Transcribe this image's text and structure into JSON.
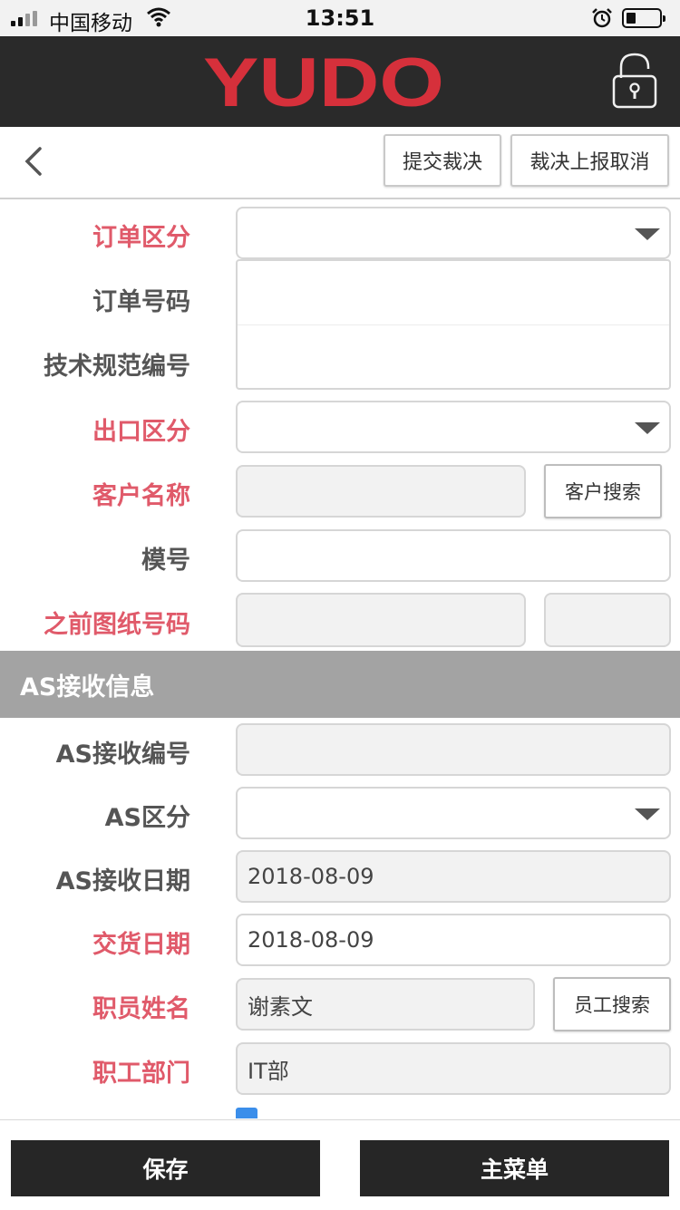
{
  "status_bar": {
    "carrier": "中国移动",
    "time": "13:51"
  },
  "header": {
    "logo_text": "YUDO",
    "brand_color": "#d6303b",
    "lock_icon": "lock-icon"
  },
  "toolbar": {
    "back_icon": "chevron-left-icon",
    "submit_label": "提交裁决",
    "cancel_report_label": "裁决上报取消"
  },
  "form": {
    "order_type": {
      "label": "订单区分",
      "value": ""
    },
    "order_number": {
      "label": "订单号码",
      "value": ""
    },
    "spec_number": {
      "label": "技术规范编号",
      "value": ""
    },
    "export_type": {
      "label": "出口区分",
      "value": ""
    },
    "customer_name": {
      "label": "客户名称",
      "value": "",
      "search_label": "客户搜索"
    },
    "model_no": {
      "label": "模号",
      "value": ""
    },
    "previous_drawing": {
      "label": "之前图纸号码",
      "value": "",
      "value2": ""
    }
  },
  "as_section": {
    "title": "AS接收信息",
    "receipt_no": {
      "label": "AS接收编号",
      "value": ""
    },
    "as_type": {
      "label": "AS区分",
      "value": ""
    },
    "receipt_date": {
      "label": "AS接收日期",
      "value": "2018-08-09"
    },
    "delivery_date": {
      "label": "交货日期",
      "value": "2018-08-09"
    },
    "employee_name": {
      "label": "职员姓名",
      "value": "谢素文",
      "search_label": "员工搜索"
    },
    "department": {
      "label": "职工部门",
      "value": "IT部"
    }
  },
  "bottom_bar": {
    "save_label": "保存",
    "main_menu_label": "主菜单"
  }
}
